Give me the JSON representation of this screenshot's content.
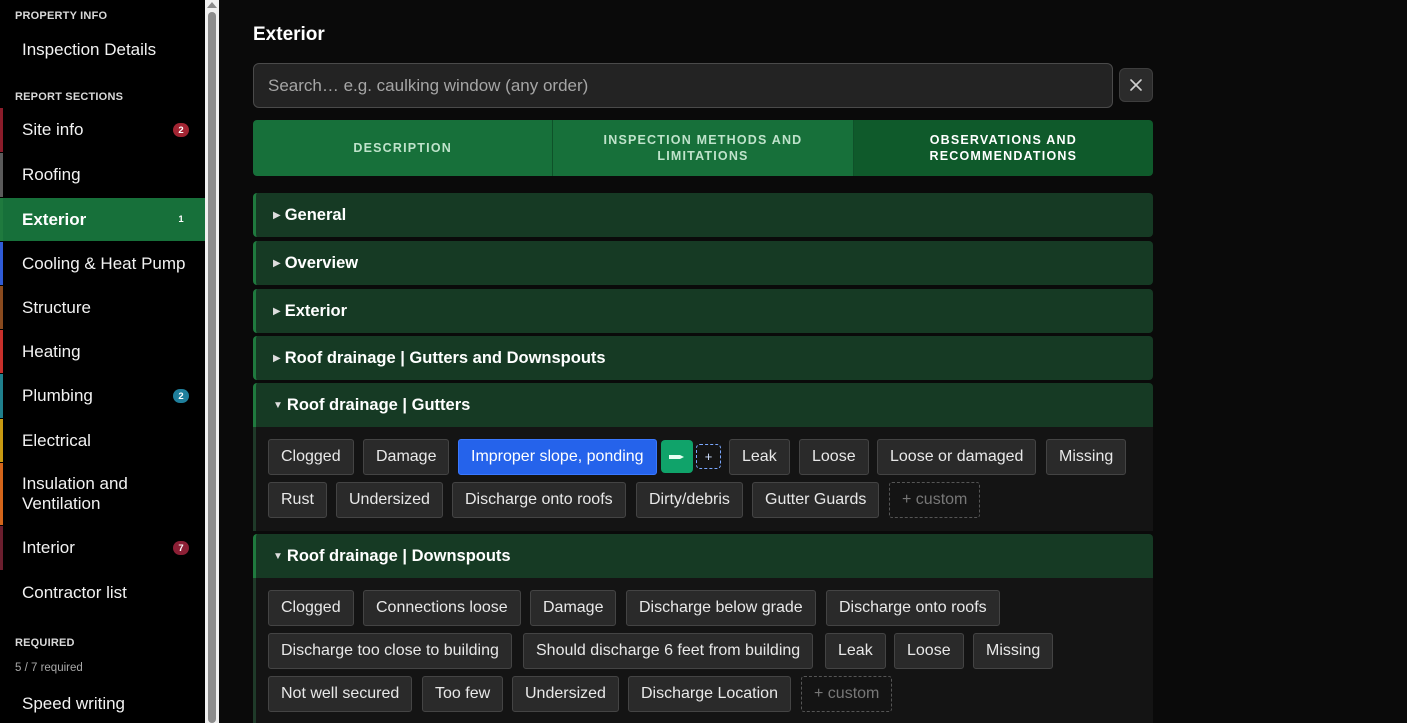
{
  "sidebar": {
    "property_heading": "PROPERTY INFO",
    "inspection_details": "Inspection Details",
    "report_heading": "REPORT SECTIONS",
    "items": [
      {
        "label": "Site info",
        "badge": "2",
        "color": "#8b1c2a",
        "badge_color": "#a12432"
      },
      {
        "label": "Roofing",
        "badge": "",
        "color": "#5a5a5a"
      },
      {
        "label": "Exterior",
        "badge": "1",
        "color": "#1f7a3e",
        "badge_color": "#17703a"
      },
      {
        "label": "Cooling & Heat Pump",
        "badge": "",
        "color": "#2f5bd6"
      },
      {
        "label": "Structure",
        "badge": "",
        "color": "#8a4a1e"
      },
      {
        "label": "Heating",
        "badge": "",
        "color": "#c8302b"
      },
      {
        "label": "Plumbing",
        "badge": "2",
        "color": "#1f7f8c",
        "badge_color": "#1f7f9c"
      },
      {
        "label": "Electrical",
        "badge": "",
        "color": "#c99a12"
      },
      {
        "label": "Insulation and Ventilation",
        "badge": "",
        "color": "#d4651a"
      },
      {
        "label": "Interior",
        "badge": "7",
        "color": "#6b1e2e",
        "badge_color": "#8c1f35"
      },
      {
        "label": "Contractor list",
        "badge": "",
        "color": ""
      }
    ],
    "required_heading": "REQUIRED",
    "required_count": "5 / 7 required",
    "speed_writing": "Speed writing"
  },
  "main": {
    "title": "Exterior",
    "search_placeholder": "Search… e.g. caulking window (any order)",
    "tabs": [
      "DESCRIPTION",
      "INSPECTION METHODS AND LIMITATIONS",
      "OBSERVATIONS AND RECOMMENDATIONS"
    ],
    "sections": [
      {
        "label": "General",
        "expanded": false
      },
      {
        "label": "Overview",
        "expanded": false
      },
      {
        "label": "Exterior",
        "expanded": false
      },
      {
        "label": "Roof drainage | Gutters and Downspouts",
        "expanded": false
      },
      {
        "label": "Roof drainage | Gutters",
        "expanded": true
      },
      {
        "label": "Roof drainage | Downspouts",
        "expanded": true
      }
    ],
    "gutters_chips": [
      "Clogged",
      "Damage",
      "Improper slope, ponding",
      "Leak",
      "Loose",
      "Loose or damaged",
      "Missing",
      "Rust",
      "Undersized",
      "Discharge onto roofs",
      "Dirty/debris",
      "Gutter Guards",
      "+ custom"
    ],
    "downspouts_chips": [
      "Clogged",
      "Connections loose",
      "Damage",
      "Discharge below grade",
      "Discharge onto roofs",
      "Discharge too close to building",
      "Should discharge 6 feet from building",
      "Leak",
      "Loose",
      "Missing",
      "Not well secured",
      "Too few",
      "Undersized",
      "Discharge Location",
      "+ custom"
    ],
    "add_label": "+"
  }
}
